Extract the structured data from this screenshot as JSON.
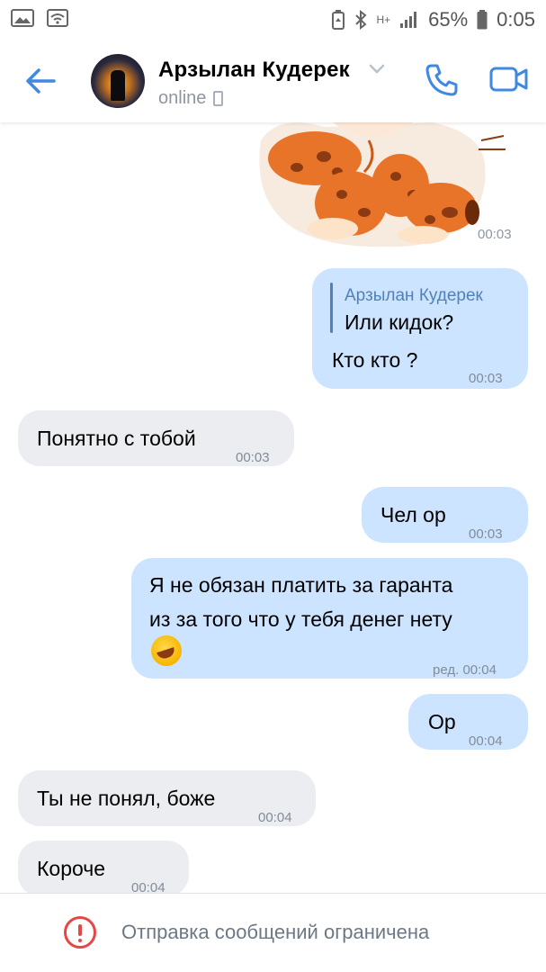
{
  "status_bar": {
    "battery_percent": "65%",
    "time": "0:05",
    "network": "H+",
    "icons": [
      "image-icon",
      "wifi-icon",
      "battery-saver-icon",
      "bluetooth-icon",
      "network-icon",
      "signal-icon",
      "battery-icon"
    ]
  },
  "header": {
    "name": "Арзылан Кудерек",
    "status": "online",
    "icons": [
      "back-arrow-icon",
      "chevron-down-icon",
      "mobile-icon",
      "phone-icon",
      "video-camera-icon"
    ],
    "accent_color": "#3f8ae0"
  },
  "messages": [
    {
      "type": "sticker",
      "direction": "out",
      "time": "00:03"
    },
    {
      "type": "text",
      "direction": "out",
      "reply_to_name": "Арзылан Кудерек",
      "reply_to_text": "Или кидок?",
      "text": "Кто кто ?",
      "time": "00:03"
    },
    {
      "type": "text",
      "direction": "in",
      "text": "Понятно с тобой",
      "time": "00:03"
    },
    {
      "type": "text",
      "direction": "out",
      "text": "Чел ор",
      "time": "00:03"
    },
    {
      "type": "text",
      "direction": "out",
      "lines": [
        "Я не обязан  платить за гаранта",
        "из за того что у тебя денег нету"
      ],
      "emoji": "rolling-on-floor-laughing",
      "time": "ред. 00:04"
    },
    {
      "type": "text",
      "direction": "out",
      "text": "Ор",
      "time": "00:04"
    },
    {
      "type": "text",
      "direction": "in",
      "text": "Ты не понял, боже",
      "time": "00:04"
    },
    {
      "type": "text",
      "direction": "in",
      "text": "Короче",
      "time": "00:04"
    }
  ],
  "bottom_bar": {
    "notice": "Отправка сообщений ограничена",
    "icon": "warning-icon",
    "color": "#e64646"
  },
  "colors": {
    "outgoing_bubble": "#cce4ff",
    "incoming_bubble": "#ebedf0",
    "reply_name": "#5181b8"
  }
}
